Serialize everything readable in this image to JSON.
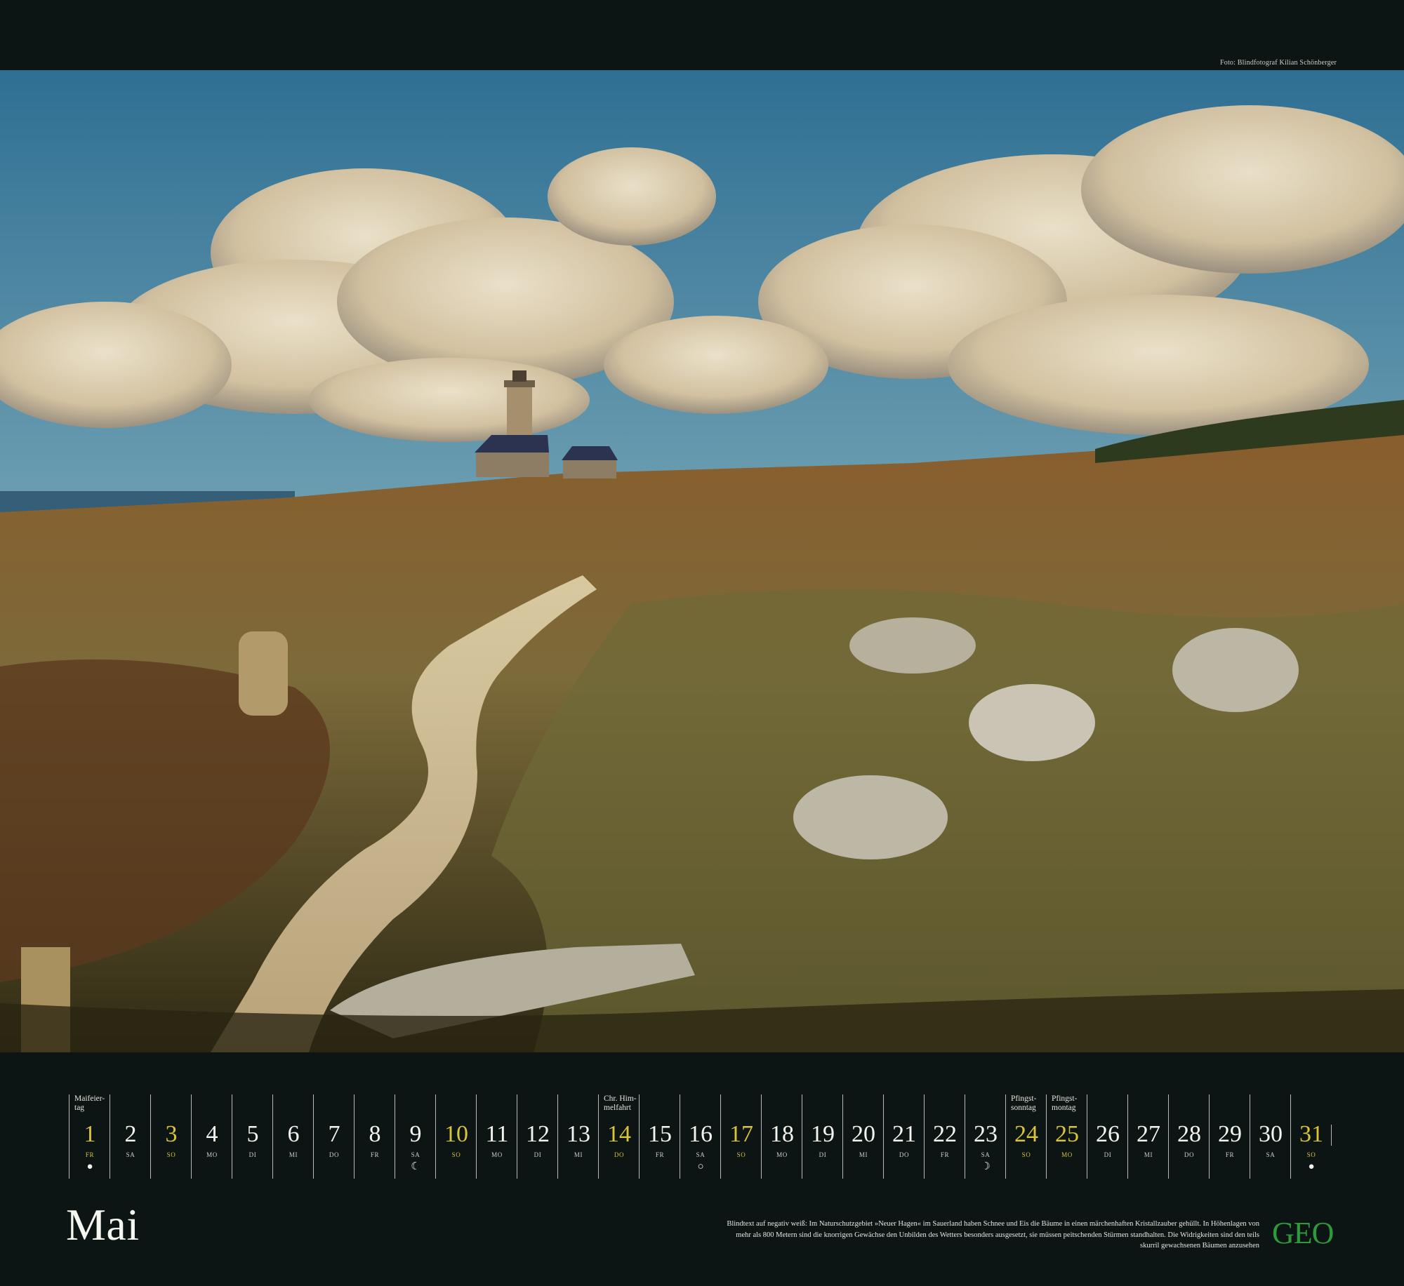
{
  "photo_credit": "Foto: Blindfotograf Kilian Schönberger",
  "month": "Mai",
  "days": [
    {
      "num": "1",
      "wd": "FR",
      "holiday": "Maifeier-\ntag",
      "sunday": true,
      "moon": "●"
    },
    {
      "num": "2",
      "wd": "SA"
    },
    {
      "num": "3",
      "wd": "SO",
      "sunday": true
    },
    {
      "num": "4",
      "wd": "MO"
    },
    {
      "num": "5",
      "wd": "DI"
    },
    {
      "num": "6",
      "wd": "MI"
    },
    {
      "num": "7",
      "wd": "DO"
    },
    {
      "num": "8",
      "wd": "FR"
    },
    {
      "num": "9",
      "wd": "SA",
      "moon": "☾"
    },
    {
      "num": "10",
      "wd": "SO",
      "sunday": true
    },
    {
      "num": "11",
      "wd": "MO"
    },
    {
      "num": "12",
      "wd": "DI"
    },
    {
      "num": "13",
      "wd": "MI"
    },
    {
      "num": "14",
      "wd": "DO",
      "holiday": "Chr. Him-\nmelfahrt",
      "sunday": true
    },
    {
      "num": "15",
      "wd": "FR"
    },
    {
      "num": "16",
      "wd": "SA",
      "moon": "○"
    },
    {
      "num": "17",
      "wd": "SO",
      "sunday": true
    },
    {
      "num": "18",
      "wd": "MO"
    },
    {
      "num": "19",
      "wd": "DI"
    },
    {
      "num": "20",
      "wd": "MI"
    },
    {
      "num": "21",
      "wd": "DO"
    },
    {
      "num": "22",
      "wd": "FR"
    },
    {
      "num": "23",
      "wd": "SA",
      "moon": "☽"
    },
    {
      "num": "24",
      "wd": "SO",
      "holiday": "Pfingst-\nsonntag",
      "sunday": true
    },
    {
      "num": "25",
      "wd": "MO",
      "holiday": "Pfingst-\nmontag",
      "sunday": true
    },
    {
      "num": "26",
      "wd": "DI"
    },
    {
      "num": "27",
      "wd": "MI"
    },
    {
      "num": "28",
      "wd": "DO"
    },
    {
      "num": "29",
      "wd": "FR"
    },
    {
      "num": "30",
      "wd": "SA"
    },
    {
      "num": "31",
      "wd": "SO",
      "sunday": true,
      "moon": "●"
    }
  ],
  "blurb": "Blindtext auf negativ weiß: Im Naturschutzgebiet »Neuer Hagen« im Sauerland haben Schnee und Eis die Bäume in einen märchenhaften Kristallzauber gehüllt. In Höhenlagen von mehr als 800 Metern sind die knorrigen Gewächse den Unbilden des Wetters besonders ausgesetzt, sie müssen peitschenden Stürmen standhalten. Die Widrigkeiten sind den teils skurril gewachsenen Bäumen anzusehen",
  "logo": "GEO",
  "colors": {
    "background": "#0d1414",
    "sunday": "#d9c33a",
    "logo": "#2f9a3a"
  }
}
